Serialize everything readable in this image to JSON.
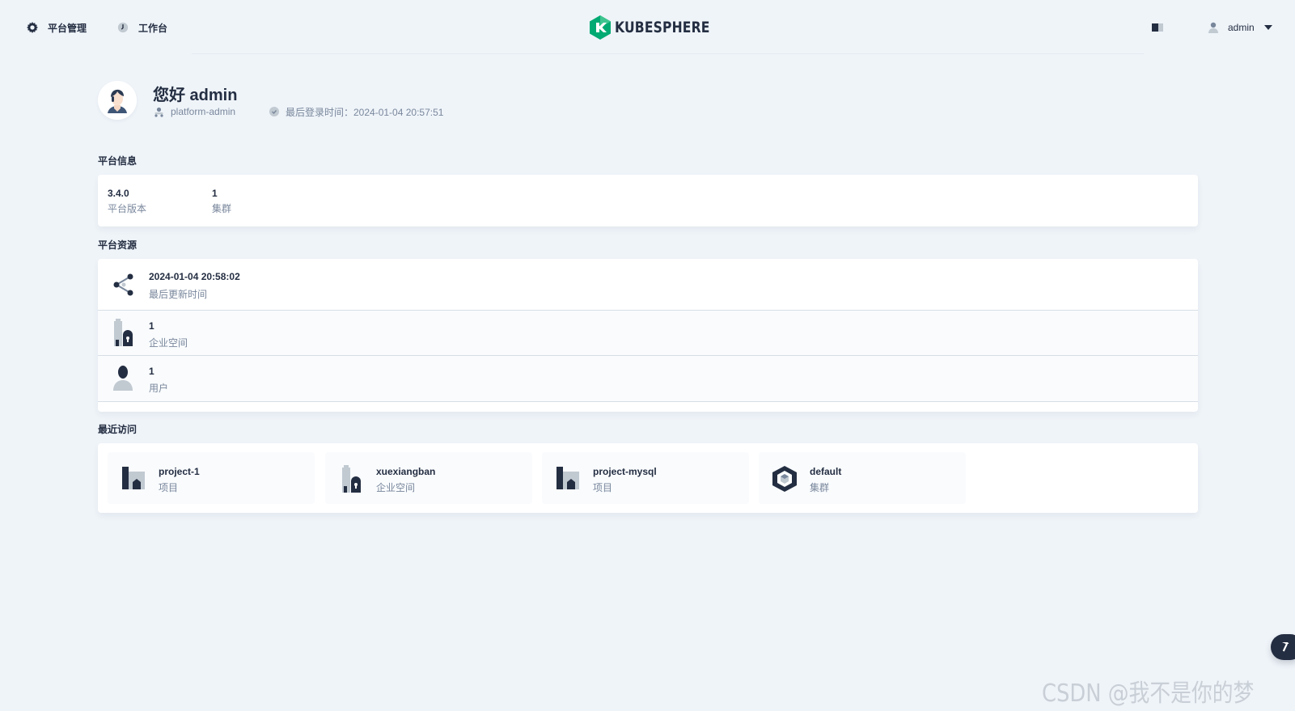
{
  "header": {
    "nav": [
      {
        "label": "平台管理",
        "icon": "gear-icon"
      },
      {
        "label": "工作台",
        "icon": "clock-icon"
      }
    ],
    "logo_text": "KUBESPHERE",
    "user": {
      "name": "admin"
    }
  },
  "profile": {
    "greeting": "您好 admin",
    "role": "platform-admin",
    "last_login": "最后登录时间：2024-01-04 20:57:51"
  },
  "platform_info": {
    "title": "平台信息",
    "items": [
      {
        "value": "3.4.0",
        "label": "平台版本"
      },
      {
        "value": "1",
        "label": "集群"
      }
    ]
  },
  "platform_resources": {
    "title": "平台资源",
    "items": [
      {
        "value": "2024-01-04 20:58:02",
        "label": "最后更新时间",
        "icon": "share-nodes-icon"
      },
      {
        "value": "1",
        "label": "企业空间",
        "icon": "workspace-icon"
      },
      {
        "value": "1",
        "label": "用户",
        "icon": "user-icon"
      }
    ]
  },
  "recent": {
    "title": "最近访问",
    "items": [
      {
        "name": "project-1",
        "type": "项目",
        "icon": "project-icon"
      },
      {
        "name": "xuexiangban",
        "type": "企业空间",
        "icon": "workspace-icon"
      },
      {
        "name": "project-mysql",
        "type": "项目",
        "icon": "project-icon"
      },
      {
        "name": "default",
        "type": "集群",
        "icon": "cluster-icon"
      }
    ]
  },
  "watermark": "CSDN @我不是你的梦",
  "colors": {
    "brand": "#00aa72",
    "text": "#242e42",
    "muted": "#79879c",
    "background": "#eff4f9"
  }
}
